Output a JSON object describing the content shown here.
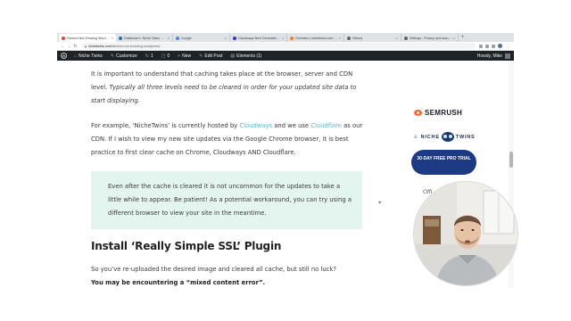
{
  "browser": {
    "tabs": [
      {
        "label": "Favicon Not Showing WordPress",
        "active": true,
        "color": "#e94235"
      },
      {
        "label": "Dashboard ‹ Niche Twins — WordPress",
        "active": false,
        "color": "#2271b1"
      },
      {
        "label": "Google",
        "active": false,
        "color": "#4285f4"
      },
      {
        "label": "Cloudways Next Generation Cloud",
        "active": false,
        "color": "#2c39bd"
      },
      {
        "label": "Overview | nichetwins.com | Account",
        "active": false,
        "color": "#f38020"
      },
      {
        "label": "History",
        "active": false,
        "color": "#5f6368"
      },
      {
        "label": "Settings - Privacy and security",
        "active": false,
        "color": "#5f6368"
      }
    ],
    "new_tab": "+",
    "url_domain": "nichetwins.com",
    "url_path": "/favicon-not-showing-wordpress/",
    "back": "←",
    "forward": "→",
    "reload": "↻"
  },
  "wp_admin_bar": {
    "logo": "W",
    "items": [
      {
        "icon": "⌂",
        "label": "Niche Twins"
      },
      {
        "icon": "✎",
        "label": "Customize"
      },
      {
        "icon": "↻",
        "label": "1"
      },
      {
        "icon": "▢",
        "label": "0"
      },
      {
        "icon": "+",
        "label": "New"
      },
      {
        "icon": "✎",
        "label": "Edit Post"
      },
      {
        "icon": "▤",
        "label": "Elements (1)"
      }
    ],
    "howdy": "Howdy, Mike"
  },
  "article": {
    "p1_plain": "It is important to understand that caching takes place at the browser, server and CDN level. ",
    "p1_italic": "Typically all three levels need to be cleared in order for your updated site data to start displaying.",
    "p2_a": "For example, ‘NicheTwins’ is currently hosted by ",
    "p2_link1": "Cloudways",
    "p2_b": " and we use ",
    "p2_link2": "Cloudflare",
    "p2_c": " as our CDN. If I wish to view my new site updates via the Google Chrome browser, it is best practice to first clear cache on Chrome, Cloudways AND Cloudflare.",
    "callout": "Even after the cache is cleared it is not uncommon for the updates to take a little while to appear. Be patient! As a potential workaround, you can try using a different browser to view your site in the meantime.",
    "heading": "Install ‘Really Simple SSL’ Plugin",
    "p3": "So you’ve re-uploaded the desired image and cleared all cache, but still no luck?",
    "p3_bold": "You may be encountering a “mixed content error”."
  },
  "sidebar": {
    "semrush": "SEMRUSH",
    "amp": "&",
    "niche_left": "NICHE",
    "niche_right": "TWINS",
    "cta": "30-DAY FREE PRO TRIAL",
    "offer": "Offi"
  },
  "colors": {
    "link": "#5fb7d1",
    "callout_bg": "#e4f4ef",
    "admin_bar": "#1d2327",
    "cta_bg": "#1d3a84",
    "semrush": "#ff642d"
  }
}
